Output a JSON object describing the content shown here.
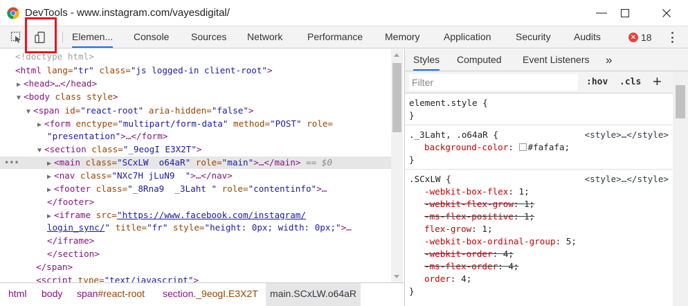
{
  "window": {
    "title": "DevTools - www.instagram.com/vayesdigital/",
    "min_glyph": "—",
    "max_glyph": "☐",
    "close_glyph": "✕"
  },
  "toolbar": {
    "tabs": [
      {
        "label": "Elemen...",
        "active": true
      },
      {
        "label": "Console"
      },
      {
        "label": "Sources"
      },
      {
        "label": "Network"
      },
      {
        "label": "Performance"
      },
      {
        "label": "Memory"
      },
      {
        "label": "Application"
      },
      {
        "label": "Security"
      },
      {
        "label": "Audits"
      }
    ],
    "error_count": "18",
    "error_glyph": "✕"
  },
  "elements": {
    "doctype": "<!doctype html>",
    "html_open": "<html",
    "html_lang_attr": " lang=",
    "html_lang_val": "\"tr\"",
    "html_class_attr": " class=",
    "html_class_val": "\"js logged-in client-root\"",
    "html_close": ">",
    "head": "<head>…</head>",
    "body_open": "<body",
    "body_attr": " class style",
    "body_close": ">",
    "span_open": "<span",
    "span_id_attr": " id=",
    "span_id_val": "\"react-root\"",
    "span_aria_attr": " aria-hidden=",
    "span_aria_val": "\"false\"",
    "span_close": ">",
    "form_open": "<form",
    "form_enctype_attr": " enctype=",
    "form_enctype_val": "\"multipart/form-data\"",
    "form_method_attr": " method=",
    "form_method_val": "\"POST\"",
    "form_role_attr": " role=",
    "form_role_val": "\"presentation\"",
    "form_rest": ">…</form>",
    "section_open": "<section",
    "section_class_attr": " class=",
    "section_class_val": "\"_9eogI E3X2T\"",
    "section_close": ">",
    "main_open": "<main",
    "main_class_attr": " class=",
    "main_class_val": "\"SCxLW  o64aR\"",
    "main_role_attr": " role=",
    "main_role_val": "\"main\"",
    "main_rest": ">…</main>",
    "main_eq": " == $0",
    "nav_open": "<nav",
    "nav_class_attr": " class=",
    "nav_class_val": "\"NXc7H jLuN9  \"",
    "nav_rest": ">…</nav>",
    "footer_open": "<footer",
    "footer_class_attr": " class=",
    "footer_class_val": "\"_8Rna9  _3Laht \"",
    "footer_role_attr": " role=",
    "footer_role_val": "\"contentinfo\"",
    "footer_rest": ">…",
    "footer_end": "</footer>",
    "iframe_open": "<iframe",
    "iframe_src_attr": " src=",
    "iframe_src_val_1": "\"https://www.facebook.com/instagram/",
    "iframe_src_val_2": "login_sync/",
    "iframe_src_quote": "\"",
    "iframe_title_attr": " title=",
    "iframe_title_val": "\"fr\"",
    "iframe_style_attr": " style=",
    "iframe_style_val": "\"height: 0px; width: 0px;\"",
    "iframe_rest": ">…",
    "iframe_end": "</iframe>",
    "section_end": "</section>",
    "span_end": "</span>",
    "script_open": "<script",
    "script_type_attr": " type=",
    "script_type_val": "\"text/javascript\"",
    "script_rest": ">"
  },
  "breadcrumbs": [
    {
      "tag": "html",
      "cls": ""
    },
    {
      "tag": "body",
      "cls": ""
    },
    {
      "tag": "span",
      "cls": "#react-root"
    },
    {
      "tag": "section",
      "cls": "._9eogI.E3X2T"
    },
    {
      "tag": "main",
      "cls": ".SCxLW.o64aR",
      "active": true
    }
  ],
  "styles": {
    "tabs": [
      {
        "label": "Styles",
        "active": true
      },
      {
        "label": "Computed"
      },
      {
        "label": "Event Listeners"
      }
    ],
    "more_glyph": "»",
    "filter_placeholder": "Filter",
    "hov": ":hov",
    "cls": ".cls",
    "add": "+",
    "rules": {
      "element_style_sel": "element.style {",
      "close_brace": "}",
      "r1_sel": "._3Laht, .o64aR {",
      "r1_src": "<style>…</style>",
      "r1_prop": "background-color",
      "r1_val": "#fafafa",
      "r2_sel": ".SCxLW {",
      "r2_src": "<style>…</style>",
      "r2_props": [
        {
          "prop": "-webkit-box-flex",
          "val": "1",
          "struck": false
        },
        {
          "prop": "-webkit-flex-grow",
          "val": "1",
          "struck": true
        },
        {
          "prop": "-ms-flex-positive",
          "val": "1",
          "struck": true
        },
        {
          "prop": "flex-grow",
          "val": "1",
          "struck": false
        },
        {
          "prop": "-webkit-box-ordinal-group",
          "val": "5",
          "struck": false
        },
        {
          "prop": "-webkit-order",
          "val": "4",
          "struck": true
        },
        {
          "prop": "-ms-flex-order",
          "val": "4",
          "struck": true
        },
        {
          "prop": "order",
          "val": "4",
          "struck": false
        }
      ]
    }
  }
}
